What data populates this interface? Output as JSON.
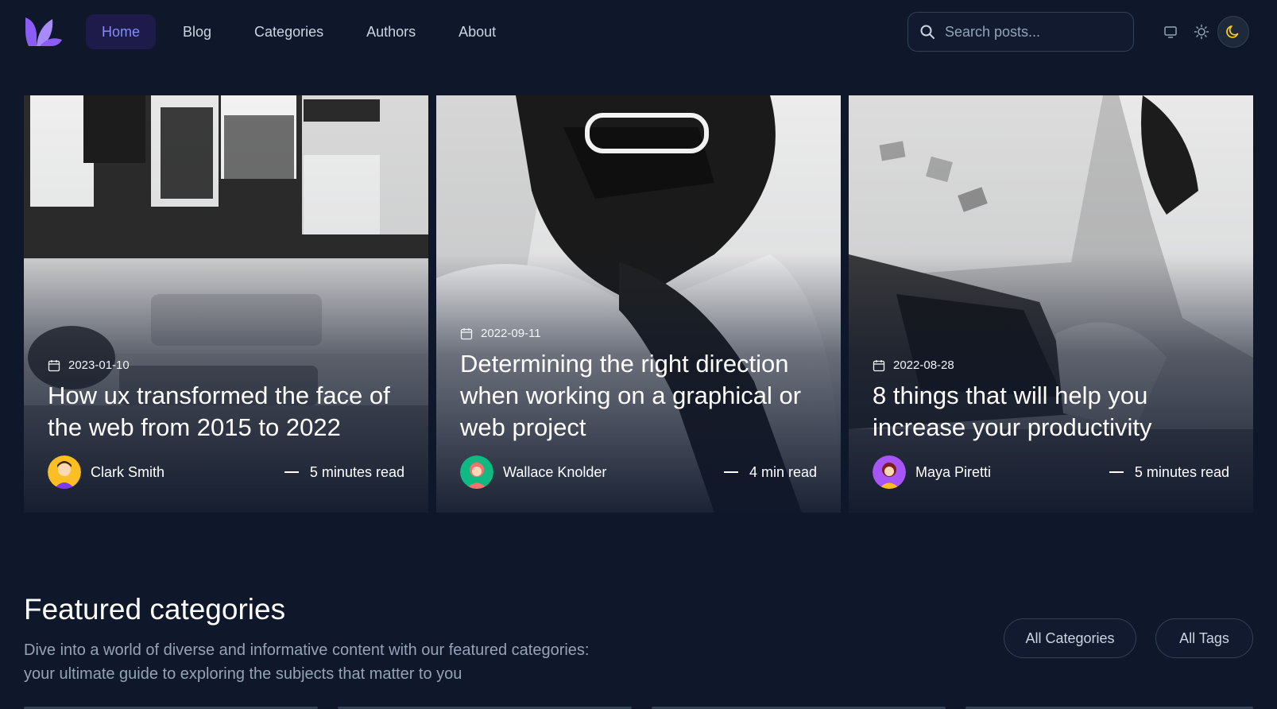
{
  "header": {
    "logo_name": "purple-leaf-logo",
    "nav": [
      {
        "label": "Home",
        "active": true
      },
      {
        "label": "Blog"
      },
      {
        "label": "Categories"
      },
      {
        "label": "Authors"
      },
      {
        "label": "About"
      }
    ],
    "search": {
      "placeholder": "Search posts..."
    },
    "theme_modes": [
      "system-icon",
      "sun-icon",
      "moon-icon"
    ],
    "active_theme": "moon-icon"
  },
  "posts": [
    {
      "date": "2023-01-10",
      "title": "How ux transformed the face of the web from 2015 to 2022",
      "author": "Clark Smith",
      "read": "5 minutes read"
    },
    {
      "date": "2022-09-11",
      "title": "Determining the right direction when working on a graphical or web project",
      "author": "Wallace Knolder",
      "read": "4 min read"
    },
    {
      "date": "2022-08-28",
      "title": "8 things that will help you increase your productivity",
      "author": "Maya Piretti",
      "read": "5 minutes read"
    }
  ],
  "featured": {
    "title": "Featured categories",
    "description": "Dive into a world of diverse and informative content with our featured categories: your ultimate guide to exploring the subjects that matter to you",
    "buttons": {
      "all_categories": "All Categories",
      "all_tags": "All Tags"
    }
  },
  "colors": {
    "background": "#0f172a",
    "accent": "#818cf8",
    "brand": "#8b5cf6"
  }
}
